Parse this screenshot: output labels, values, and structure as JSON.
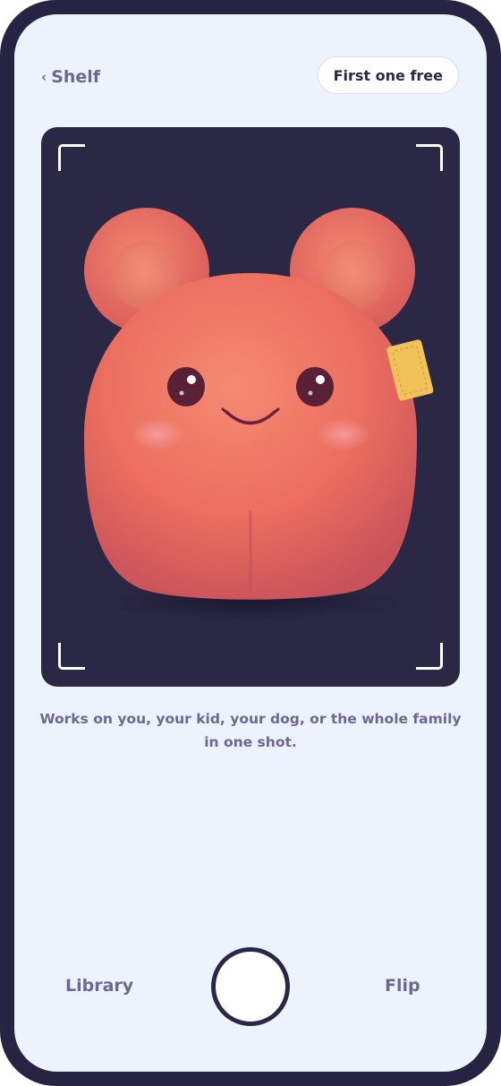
{
  "header": {
    "back_label": "Shelf",
    "promo_label": "First one free"
  },
  "viewfinder": {
    "subject": "coral plush toy"
  },
  "caption": "Works on you, your kid, your dog, or the whole family in one shot.",
  "controls": {
    "library_label": "Library",
    "flip_label": "Flip"
  },
  "colors": {
    "frame": "#272443",
    "screen_bg": "#edf3fd",
    "viewfinder_bg": "#2a2844",
    "muted_text": "#6e6794",
    "dark_text": "#2b2749",
    "plush": "#ee6f5e"
  },
  "icons": {
    "back": "chevron-left-icon",
    "shutter": "shutter-button"
  }
}
